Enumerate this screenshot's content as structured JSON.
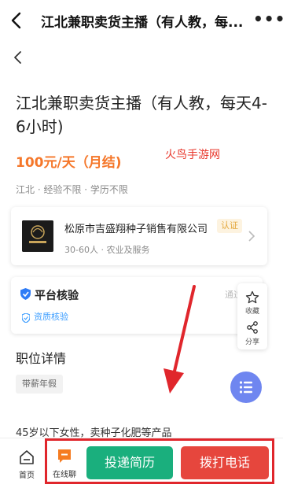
{
  "header": {
    "title": "江北兼职卖货主播（有人教，每...",
    "more": "•••"
  },
  "job": {
    "title": "江北兼职卖货主播（有人教，每天4-6小时)",
    "salary": "100元/天（月结)",
    "meta": "江北 · 经验不限 · 学历不限"
  },
  "watermark": "火鸟手游网",
  "company": {
    "name": "松原市吉盛翔种子销售有限公司",
    "badge": "认证",
    "sub": "30-60人 · 农业及服务"
  },
  "platform": {
    "title": "平台核验",
    "sub": "资质核验",
    "tail": "通过"
  },
  "floating": {
    "favorite_label": "收藏",
    "share_label": "分享"
  },
  "details": {
    "section_title": "职位详情",
    "tag": "带薪年假",
    "description": "45岁以下女性，卖种子化肥等产品"
  },
  "bottom": {
    "home_label": "首页",
    "chat_label": "在线聊",
    "apply_label": "投递简历",
    "call_label": "拨打电话"
  },
  "colors": {
    "salary": "#f5772a",
    "apply": "#1aaf7d",
    "call": "#e6463d",
    "highlight": "#e0262c",
    "fab": "#6f86f0"
  }
}
